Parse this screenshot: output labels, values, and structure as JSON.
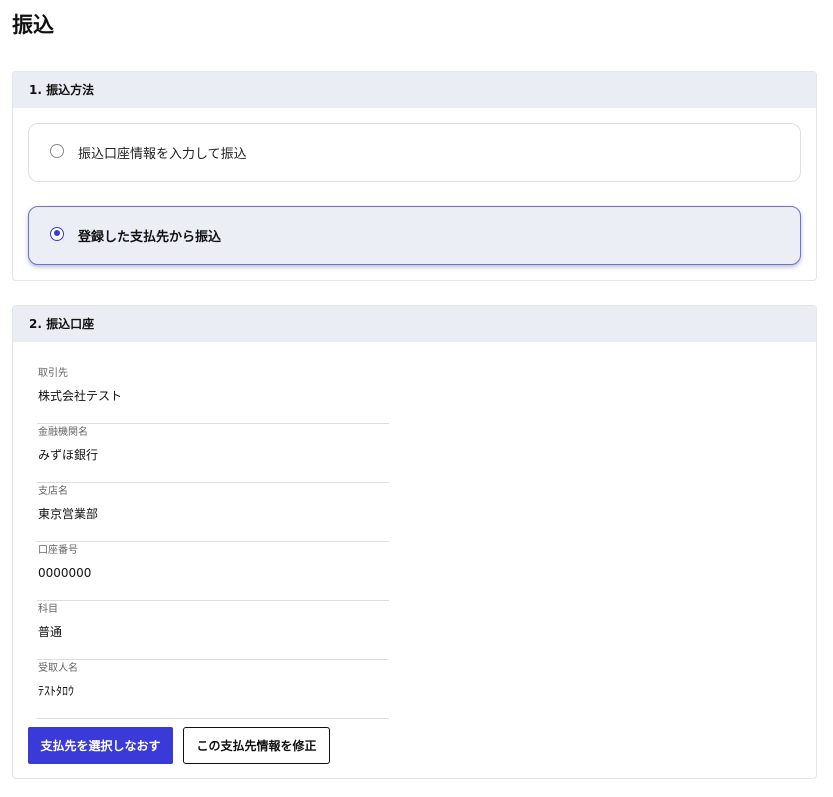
{
  "page": {
    "title": "振込"
  },
  "method_section": {
    "heading": "1. 振込方法",
    "options": [
      {
        "label": "振込口座情報を入力して振込",
        "selected": false
      },
      {
        "label": "登録した支払先から振込",
        "selected": true
      }
    ]
  },
  "account_section": {
    "heading": "2. 振込口座",
    "fields": [
      {
        "label": "取引先",
        "value": "株式会社テスト"
      },
      {
        "label": "金融機関名",
        "value": "みずほ銀行"
      },
      {
        "label": "支店名",
        "value": "東京営業部"
      },
      {
        "label": "口座番号",
        "value": "0000000"
      },
      {
        "label": "科目",
        "value": "普通"
      },
      {
        "label": "受取人名",
        "value": "ﾃｽﾄﾀﾛｳ"
      }
    ],
    "buttons": {
      "reselect_label": "支払先を選択しなおす",
      "edit_label": "この支払先情報を修正"
    }
  },
  "colors": {
    "accent": "#3a3ad8",
    "header_bg": "#eaeef4",
    "selected_card_bg": "#eceef5"
  }
}
